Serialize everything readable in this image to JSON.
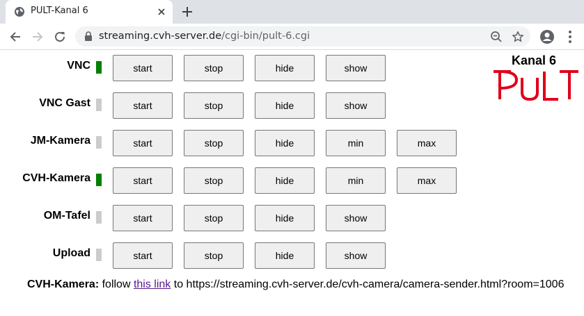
{
  "browser": {
    "tab_title": "PULT-Kanal 6",
    "url_host": "streaming.cvh-server.de",
    "url_path": "/cgi-bin/pult-6.cgi"
  },
  "brand": {
    "title": "Kanal 6",
    "logo_text": "PULT",
    "logo_color": "#e0001a"
  },
  "colors": {
    "active": "#008000",
    "inactive": "#cccccc"
  },
  "rows": [
    {
      "label": "VNC",
      "status": "active",
      "buttons": [
        "start",
        "stop",
        "hide",
        "show"
      ]
    },
    {
      "label": "VNC Gast",
      "status": "inactive",
      "buttons": [
        "start",
        "stop",
        "hide",
        "show"
      ]
    },
    {
      "label": "JM-Kamera",
      "status": "inactive",
      "buttons": [
        "start",
        "stop",
        "hide",
        "min",
        "max"
      ]
    },
    {
      "label": "CVH-Kamera",
      "status": "active",
      "buttons": [
        "start",
        "stop",
        "hide",
        "min",
        "max"
      ]
    },
    {
      "label": "OM-Tafel",
      "status": "inactive",
      "buttons": [
        "start",
        "stop",
        "hide",
        "show"
      ]
    },
    {
      "label": "Upload",
      "status": "inactive",
      "buttons": [
        "start",
        "stop",
        "hide",
        "show"
      ]
    }
  ],
  "footer": {
    "label": "CVH-Kamera:",
    "text_before": "follow",
    "link_text": "this link",
    "text_after": "to https://streaming.cvh-server.de/cvh-camera/camera-sender.html?room=1006"
  }
}
